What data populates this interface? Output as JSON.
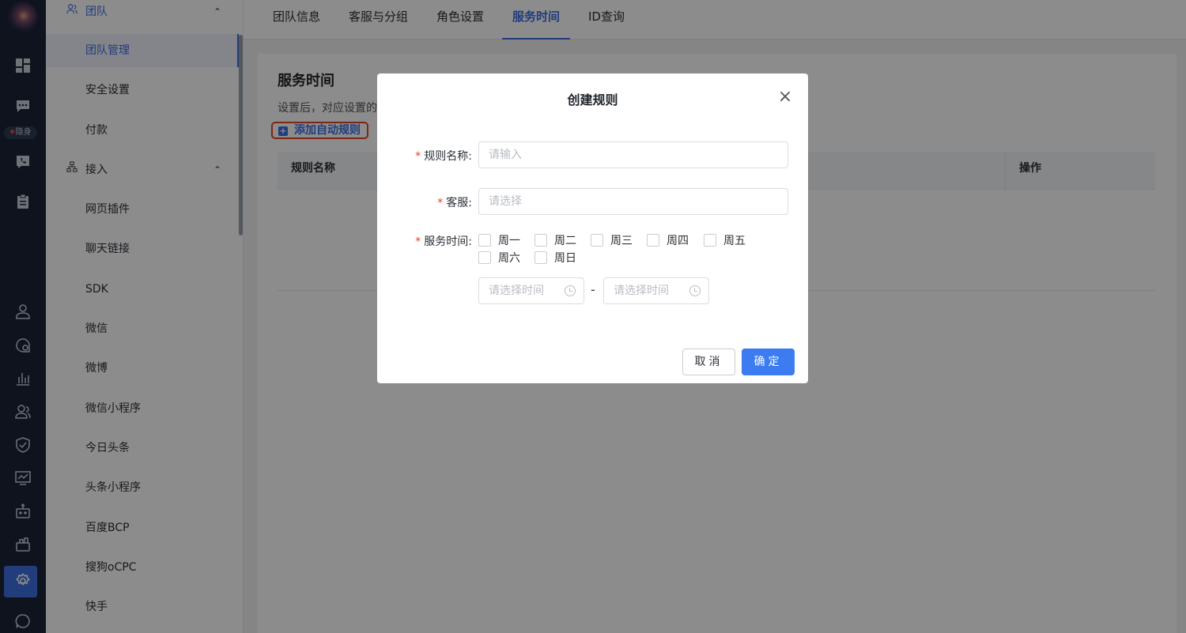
{
  "rail": {
    "status_badge": "隐身"
  },
  "sidebar": {
    "groups": [
      {
        "label": "团队",
        "icon": "team-icon"
      },
      {
        "label": "接入",
        "icon": "network-icon"
      }
    ],
    "team_items": [
      {
        "label": "团队管理",
        "selected": true
      },
      {
        "label": "安全设置"
      },
      {
        "label": "付款"
      }
    ],
    "access_items": [
      {
        "label": "网页插件"
      },
      {
        "label": "聊天链接"
      },
      {
        "label": "SDK"
      },
      {
        "label": "微信"
      },
      {
        "label": "微博"
      },
      {
        "label": "微信小程序"
      },
      {
        "label": "今日头条"
      },
      {
        "label": "头条小程序"
      },
      {
        "label": "百度BCP"
      },
      {
        "label": "搜狗oCPC"
      },
      {
        "label": "快手"
      }
    ]
  },
  "tabs": [
    {
      "label": "团队信息"
    },
    {
      "label": "客服与分组"
    },
    {
      "label": "角色设置"
    },
    {
      "label": "服务时间",
      "selected": true
    },
    {
      "label": "ID查询"
    }
  ],
  "main": {
    "title": "服务时间",
    "description": "设置后，对应设置的",
    "add_button": "添加自动规则",
    "table_headers": [
      "规则名称",
      "操作"
    ]
  },
  "modal": {
    "title": "创建规则",
    "name_label": "规则名称:",
    "name_placeholder": "请输入",
    "agent_label": "客服:",
    "agent_placeholder": "请选择",
    "time_label": "服务时间:",
    "days": [
      "周一",
      "周二",
      "周三",
      "周四",
      "周五",
      "周六",
      "周日"
    ],
    "start_time_placeholder": "请选择时间",
    "end_time_placeholder": "请选择时间",
    "range_separator": "-",
    "cancel_label": "取消",
    "ok_label": "确定"
  },
  "colors": {
    "accent": "#3d7cf0",
    "rail_bg": "#1a2336",
    "required": "#e0452b"
  }
}
